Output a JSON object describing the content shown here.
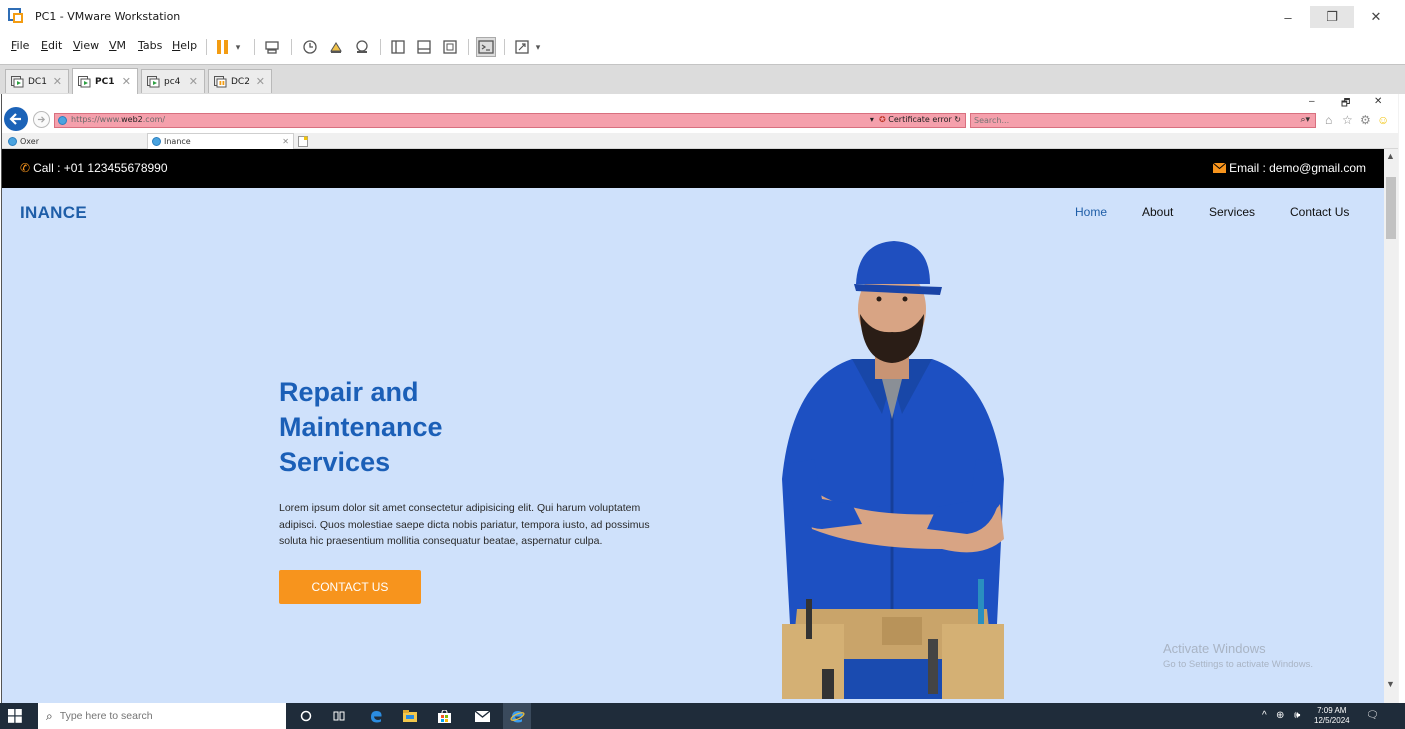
{
  "window": {
    "title": "PC1 - VMware Workstation",
    "controls": {
      "minimize": "–",
      "restore": "❐",
      "close": "✕"
    }
  },
  "menu": {
    "items": [
      {
        "label": "File",
        "accel": "F",
        "rest": "ile"
      },
      {
        "label": "Edit",
        "accel": "E",
        "rest": "dit"
      },
      {
        "label": "View",
        "accel": "V",
        "rest": "iew"
      },
      {
        "label": "VM",
        "accel": "V",
        "rest": "M"
      },
      {
        "label": "Tabs",
        "accel": "T",
        "rest": "abs"
      },
      {
        "label": "Help",
        "accel": "H",
        "rest": "elp"
      }
    ]
  },
  "vm_tabs": [
    {
      "label": "DC1",
      "active": false
    },
    {
      "label": "PC1",
      "active": true
    },
    {
      "label": "pc4",
      "active": false
    },
    {
      "label": "DC2",
      "active": false
    }
  ],
  "browser": {
    "url_prefix": "https://www.",
    "url_host": "web2",
    "url_suffix": ".com/",
    "certificate": "Certificate error",
    "search_placeholder": "Search...",
    "tabs": [
      {
        "label": "Oxer"
      },
      {
        "label": "Inance",
        "active": true
      }
    ],
    "win_controls": {
      "minimize": "–",
      "restore": "🗗",
      "close": "✕"
    }
  },
  "site": {
    "call": "Call : +01 123455678990",
    "email": "Email : demo@gmail.com",
    "brand": "INANCE",
    "nav": [
      {
        "label": "Home",
        "active": true
      },
      {
        "label": "About",
        "active": false
      },
      {
        "label": "Services",
        "active": false
      },
      {
        "label": "Contact Us",
        "active": false
      }
    ],
    "hero": {
      "title_line1": "Repair and",
      "title_line2": "Maintenance",
      "title_line3": "Services",
      "text": "Lorem ipsum dolor sit amet consectetur adipisicing elit. Qui harum voluptatem adipisci. Quos molestiae saepe dicta nobis pariatur, tempora iusto, ad possimus soluta hic praesentium mollitia consequatur beatae, aspernatur culpa.",
      "cta": "CONTACT US"
    },
    "watermark": {
      "line1": "Activate Windows",
      "line2": "Go to Settings to activate Windows."
    }
  },
  "taskbar": {
    "search_placeholder": "Type here to search",
    "time": "7:09 AM",
    "date": "12/5/2024"
  },
  "colors": {
    "brand_blue": "#1f5ea8",
    "hero_blue": "#1b5fb7",
    "accent_orange": "#f7941d",
    "hero_bg": "#cfe1fb",
    "address_error_pink": "#f5a0ac",
    "taskbar": "#1f2c3a"
  }
}
